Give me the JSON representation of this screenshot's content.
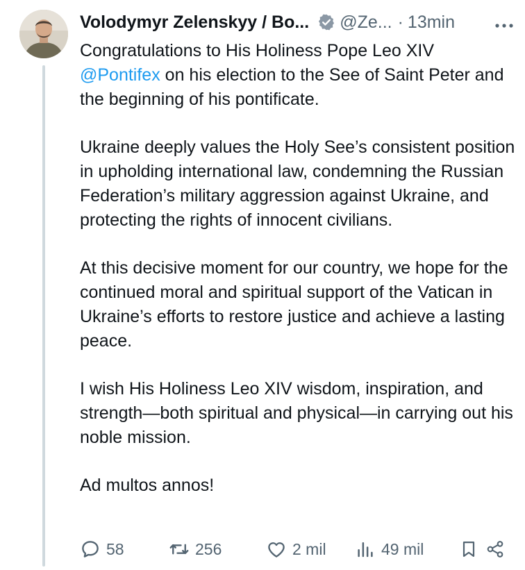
{
  "author": {
    "display_name": "Volodymyr Zelenskyy / Bo...",
    "handle": "@Ze...",
    "separator": "·",
    "timestamp": "13min",
    "more_icon": "more-options-icon",
    "verified_badge": "verified-badge-icon"
  },
  "post": {
    "p1_before": "Congratulations to His Holiness Pope Leo XIV",
    "p1_mention": "@Pontifex",
    "p1_after": " on his election to the See of Saint Peter and the beginning of his pontificate.",
    "p2": "Ukraine deeply values the Holy See’s consistent position in upholding international law, condemning the Russian Federation’s military aggression against Ukraine, and protecting the rights of innocent civilians.",
    "p3": "At this decisive moment for our country, we hope for the continued moral and spiritual support of the Vatican in Ukraine’s efforts to restore justice and achieve a lasting peace.",
    "p4": "I wish His Holiness Leo XIV wisdom, inspiration, and strength—both spiritual and physical—in carrying out his noble mission.",
    "p5": "Ad multos annos!"
  },
  "actions": {
    "replies": "58",
    "reposts": "256",
    "likes": "2 mil",
    "views": "49 mil"
  },
  "colors": {
    "text": "#0f1419",
    "muted": "#536471",
    "accent": "#1d9bf0",
    "thread_line": "#cfd9de"
  }
}
